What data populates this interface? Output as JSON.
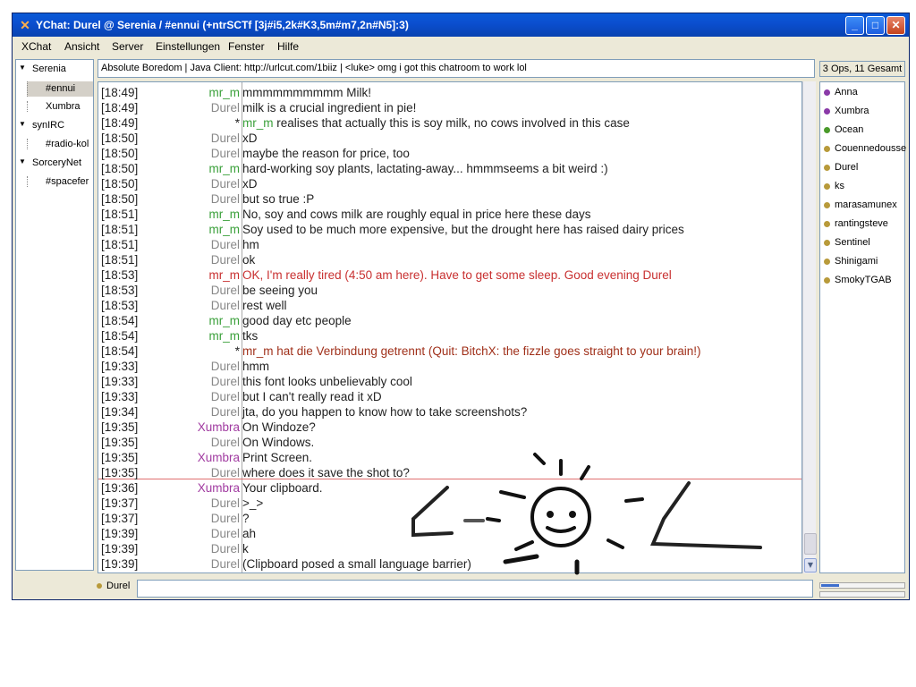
{
  "window": {
    "title": "YChat: Durel @ Serenia / #ennui (+ntrSCTf [3j#i5,2k#K3,5m#m7,2n#N5]:3)",
    "minimize_icon": "minimize-icon",
    "maximize_icon": "maximize-icon",
    "close_icon": "close-icon"
  },
  "menu": {
    "items": [
      "XChat",
      "Ansicht",
      "Server",
      "Einstellungen",
      "Fenster",
      "Hilfe"
    ]
  },
  "tree": {
    "nodes": [
      {
        "label": "Serenia",
        "type": "server"
      },
      {
        "label": "#ennui",
        "type": "channel",
        "selected": true
      },
      {
        "label": "Xumbra",
        "type": "channel"
      },
      {
        "label": "synIRC",
        "type": "server"
      },
      {
        "label": "#radio-kol",
        "type": "channel"
      },
      {
        "label": "SorceryNet",
        "type": "server"
      },
      {
        "label": "#spacefer",
        "type": "channel"
      }
    ]
  },
  "topic": "Absolute Boredom | Java Client: http://urlcut.com/1biiz | <luke> omg i got this chatroom to work lol",
  "userlist": {
    "header": "3 Ops, 11 Gesamt",
    "users": [
      {
        "name": "Anna",
        "color": "#8a3aa8"
      },
      {
        "name": "Xumbra",
        "color": "#8a3aa8"
      },
      {
        "name": "Ocean",
        "color": "#4a9a2a"
      },
      {
        "name": "Couennedousse",
        "color": "#b89a3a"
      },
      {
        "name": "Durel",
        "color": "#b89a3a"
      },
      {
        "name": "ks",
        "color": "#b89a3a"
      },
      {
        "name": "marasamunex",
        "color": "#b89a3a"
      },
      {
        "name": "rantingsteve",
        "color": "#b89a3a"
      },
      {
        "name": "Sentinel",
        "color": "#b89a3a"
      },
      {
        "name": "Shinigami",
        "color": "#b89a3a"
      },
      {
        "name": "SmokyTGAB",
        "color": "#b89a3a"
      }
    ]
  },
  "messages": [
    {
      "ts": "[18:49]",
      "nick": "mr_m",
      "nick_color": "#3aa03a",
      "text": "mmmmmmmmmm Milk!",
      "text_color": "#222222"
    },
    {
      "ts": "[18:49]",
      "nick": "Durel",
      "nick_color": "#888888",
      "text": "milk is a crucial ingredient in pie!",
      "text_color": "#222222"
    },
    {
      "ts": "[18:49]",
      "nick": "*",
      "nick_color": "#222222",
      "action_nick": "mr_m",
      "action_nick_color": "#3aa03a",
      "text": "realises that actually this is soy milk, no cows involved in this case",
      "text_color": "#222222"
    },
    {
      "ts": "[18:50]",
      "nick": "Durel",
      "nick_color": "#888888",
      "text": "xD",
      "text_color": "#222222"
    },
    {
      "ts": "[18:50]",
      "nick": "Durel",
      "nick_color": "#888888",
      "text": "maybe the reason for price, too",
      "text_color": "#222222"
    },
    {
      "ts": "[18:50]",
      "nick": "mr_m",
      "nick_color": "#3aa03a",
      "text": "hard-working soy plants, lactating-away... hmmmseems a bit weird :)",
      "text_color": "#222222"
    },
    {
      "ts": "[18:50]",
      "nick": "Durel",
      "nick_color": "#888888",
      "text": "xD",
      "text_color": "#222222"
    },
    {
      "ts": "[18:50]",
      "nick": "Durel",
      "nick_color": "#888888",
      "text": "but so true :P",
      "text_color": "#222222"
    },
    {
      "ts": "[18:51]",
      "nick": "mr_m",
      "nick_color": "#3aa03a",
      "text": "No, soy and cows milk are roughly equal in price here these days",
      "text_color": "#222222"
    },
    {
      "ts": "[18:51]",
      "nick": "mr_m",
      "nick_color": "#3aa03a",
      "text": "Soy used to be much more expensive, but the drought here has raised dairy prices",
      "text_color": "#222222"
    },
    {
      "ts": "[18:51]",
      "nick": "Durel",
      "nick_color": "#888888",
      "text": "hm",
      "text_color": "#222222"
    },
    {
      "ts": "[18:51]",
      "nick": "Durel",
      "nick_color": "#888888",
      "text": "ok",
      "text_color": "#222222"
    },
    {
      "ts": "[18:53]",
      "nick": "mr_m",
      "nick_color": "#c83030",
      "text": "OK, I'm really tired (4:50 am here). Have to get some sleep. Good evening Durel",
      "text_color": "#c83030"
    },
    {
      "ts": "[18:53]",
      "nick": "Durel",
      "nick_color": "#888888",
      "text": "be seeing you",
      "text_color": "#222222"
    },
    {
      "ts": "[18:53]",
      "nick": "Durel",
      "nick_color": "#888888",
      "text": "rest well",
      "text_color": "#222222"
    },
    {
      "ts": "[18:54]",
      "nick": "mr_m",
      "nick_color": "#3aa03a",
      "text": "good day etc people",
      "text_color": "#222222"
    },
    {
      "ts": "[18:54]",
      "nick": "mr_m",
      "nick_color": "#3aa03a",
      "text": "tks",
      "text_color": "#222222"
    },
    {
      "ts": "[18:54]",
      "nick": "*",
      "nick_color": "#222222",
      "text": "mr_m hat die Verbindung getrennt (Quit: BitchX: the fizzle goes straight to your brain!)",
      "text_color": "#a0301a"
    },
    {
      "ts": "[19:33]",
      "nick": "Durel",
      "nick_color": "#888888",
      "text": "hmm",
      "text_color": "#222222"
    },
    {
      "ts": "[19:33]",
      "nick": "Durel",
      "nick_color": "#888888",
      "text": "this font looks unbelievably cool",
      "text_color": "#222222"
    },
    {
      "ts": "[19:33]",
      "nick": "Durel",
      "nick_color": "#888888",
      "text": "but I can't really read it xD",
      "text_color": "#222222"
    },
    {
      "ts": "[19:34]",
      "nick": "Durel",
      "nick_color": "#888888",
      "text": "jta, do you happen to know how to take screenshots?",
      "text_color": "#222222"
    },
    {
      "ts": "[19:35]",
      "nick": "Xumbra",
      "nick_color": "#a03aa0",
      "text": "On Windoze?",
      "text_color": "#222222"
    },
    {
      "ts": "[19:35]",
      "nick": "Durel",
      "nick_color": "#888888",
      "text": "On Windows.",
      "text_color": "#222222"
    },
    {
      "ts": "[19:35]",
      "nick": "Xumbra",
      "nick_color": "#a03aa0",
      "text": "Print Screen.",
      "text_color": "#222222"
    },
    {
      "ts": "[19:35]",
      "nick": "Durel",
      "nick_color": "#888888",
      "text": "where does it save the shot to?",
      "text_color": "#222222"
    },
    {
      "ts": "[19:36]",
      "nick": "Xumbra",
      "nick_color": "#a03aa0",
      "text": "Your clipboard.",
      "text_color": "#222222"
    },
    {
      "ts": "[19:37]",
      "nick": "Durel",
      "nick_color": "#888888",
      "text": ">_>",
      "text_color": "#222222"
    },
    {
      "ts": "[19:37]",
      "nick": "Durel",
      "nick_color": "#888888",
      "text": "?",
      "text_color": "#222222"
    },
    {
      "ts": "[19:39]",
      "nick": "Durel",
      "nick_color": "#888888",
      "text": "ah",
      "text_color": "#222222"
    },
    {
      "ts": "[19:39]",
      "nick": "Durel",
      "nick_color": "#888888",
      "text": "k",
      "text_color": "#222222"
    },
    {
      "ts": "[19:39]",
      "nick": "Durel",
      "nick_color": "#888888",
      "text": "(Clipboard posed a small language barrier)",
      "text_color": "#222222"
    }
  ],
  "input": {
    "nick": "Durel",
    "value": "",
    "placeholder": ""
  },
  "lag_fill_fraction": 0.22
}
